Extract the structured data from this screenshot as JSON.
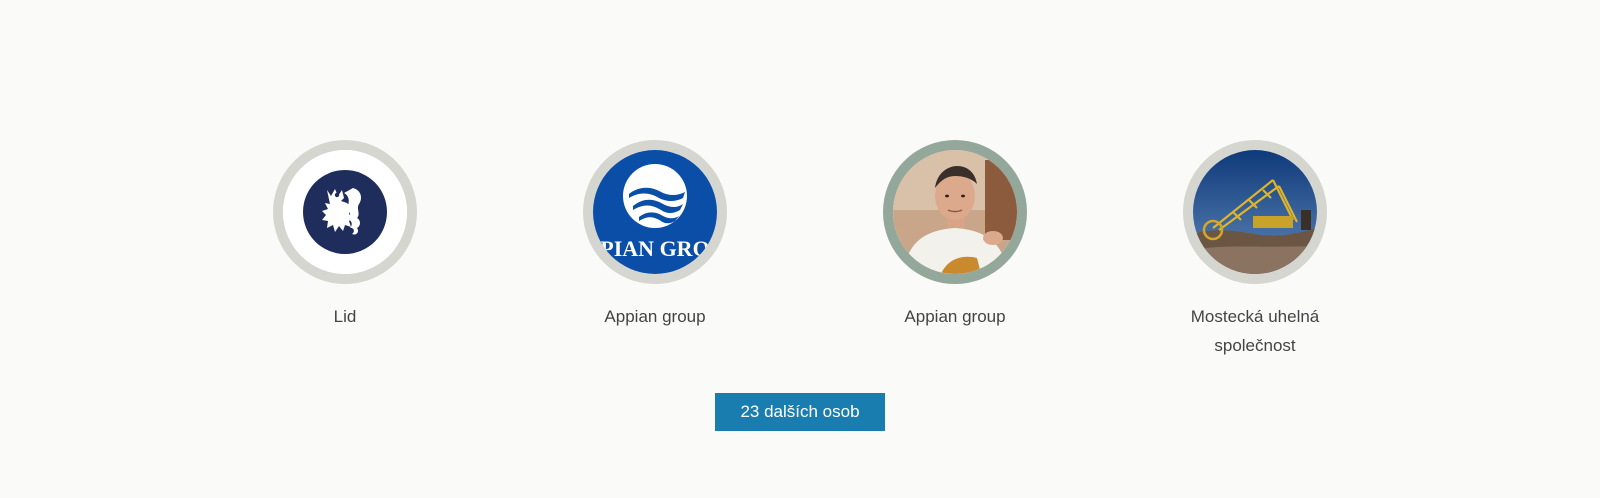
{
  "items": [
    {
      "label": "Lid",
      "image": "lion-emblem-logo"
    },
    {
      "label": "Appian group",
      "image": "appian-group-logo",
      "logo_text": "PIAN  GRO"
    },
    {
      "label": "Appian group",
      "image": "man-portrait-photo"
    },
    {
      "label": "Mostecká uhelná společnost",
      "image": "bucket-wheel-excavator-photo"
    }
  ],
  "more_button": {
    "label": "23 dalších osob"
  },
  "colors": {
    "background": "#fafaf8",
    "ring_gray": "#d6d6d0",
    "ring_green": "#93a79a",
    "button_bg": "#1a7db0",
    "navy": "#1f2d5c",
    "appian_blue": "#0a4ea8"
  }
}
